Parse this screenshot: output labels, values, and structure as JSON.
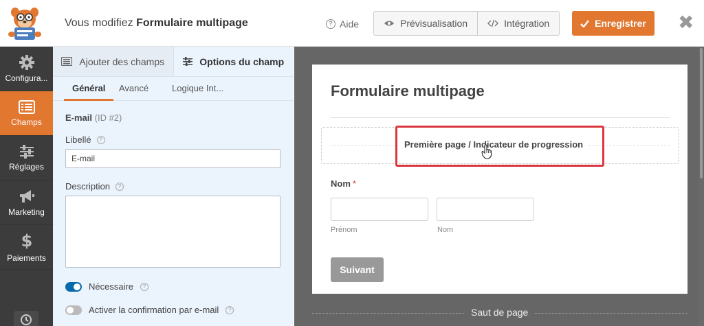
{
  "header": {
    "title_prefix": "Vous modifiez",
    "title_form": "Formulaire multipage",
    "help_label": "Aide",
    "preview_label": "Prévisualisation",
    "embed_label": "Intégration",
    "save_label": "Enregistrer",
    "close_symbol": "✖"
  },
  "sidebar": {
    "items": [
      {
        "label": "Configura...",
        "icon": "gear-icon"
      },
      {
        "label": "Champs",
        "icon": "fields-icon"
      },
      {
        "label": "Réglages",
        "icon": "sliders-icon"
      },
      {
        "label": "Marketing",
        "icon": "megaphone-icon"
      },
      {
        "label": "Paiements",
        "icon": "dollar-icon"
      }
    ]
  },
  "panel": {
    "tab_add": "Ajouter des champs",
    "tab_options": "Options du champ",
    "subtabs": [
      "Général",
      "Avancé",
      "Logique Int..."
    ],
    "field_name": "E-mail",
    "field_id": "(ID #2)",
    "label_label": "Libellé",
    "label_value": "E-mail",
    "description_label": "Description",
    "required_label": "Nécessaire",
    "confirm_label": "Activer la confirmation par e-mail",
    "required_on": true,
    "confirm_on": false
  },
  "preview": {
    "form_title": "Formulaire multipage",
    "page_label": "Première page / Indicateur de progression",
    "name_label": "Nom",
    "required_mark": "*",
    "first_sub": "Prénom",
    "last_sub": "Nom",
    "next_button": "Suivant",
    "page_break": "Saut de page"
  },
  "colors": {
    "accent": "#e27730",
    "sidebar_bg": "#3c3c3c",
    "panel_bg": "#ebf3fc",
    "preview_bg": "#666666",
    "highlight": "#d9383f",
    "toggle_on": "#056aab"
  }
}
